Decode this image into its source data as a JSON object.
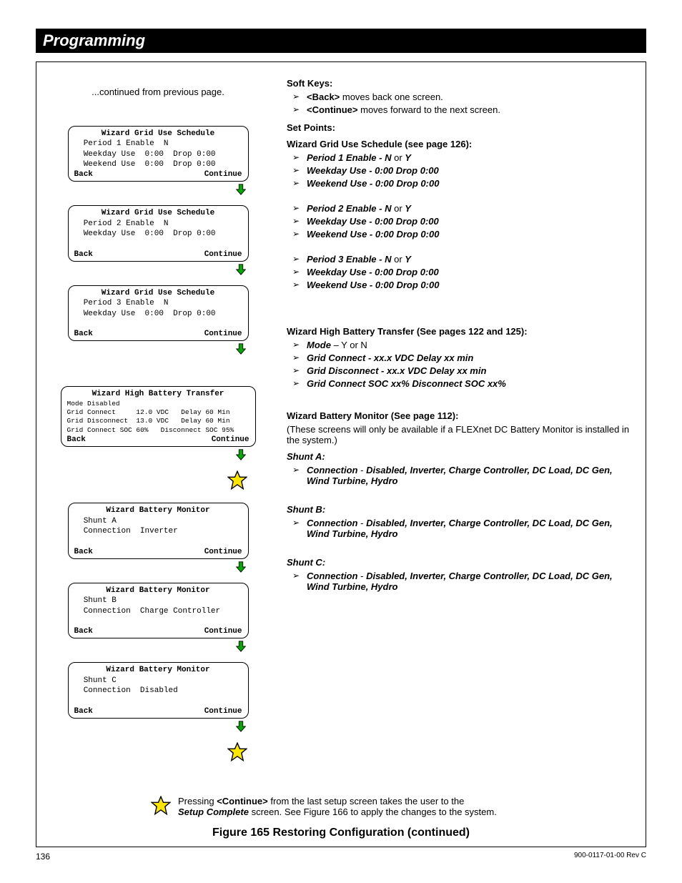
{
  "header": {
    "title": "Programming"
  },
  "continued": "...continued from previous page.",
  "lcd1": {
    "title": "Wizard Grid Use Schedule",
    "l1": "  Period 1 Enable  N",
    "l2": "  Weekday Use  0:00  Drop 0:00",
    "l3": "  Weekend Use  0:00  Drop 0:00",
    "back": "Back",
    "cont": "Continue"
  },
  "lcd2": {
    "title": "Wizard Grid Use Schedule",
    "l1": "  Period 2 Enable  N",
    "l2": "  Weekday Use  0:00  Drop 0:00",
    "back": "Back",
    "cont": "Continue"
  },
  "lcd3": {
    "title": "Wizard Grid Use Schedule",
    "l1": "  Period 3 Enable  N",
    "l2": "  Weekday Use  0:00  Drop 0:00",
    "back": "Back",
    "cont": "Continue"
  },
  "lcd4": {
    "title": "Wizard High Battery Transfer",
    "l1": "Mode Disabled",
    "l2": "Grid Connect     12.0 VDC   Delay 60 Min",
    "l3": "Grid Disconnect  13.0 VDC   Delay 60 Min",
    "l4": "Grid Connect SOC 60%   Disconnect SOC 95%",
    "back": "Back",
    "cont": "Continue"
  },
  "lcd5": {
    "title": "Wizard Battery Monitor",
    "l1": "  Shunt A",
    "l2": "  Connection  Inverter",
    "back": "Back",
    "cont": "Continue"
  },
  "lcd6": {
    "title": "Wizard Battery Monitor",
    "l1": "  Shunt B",
    "l2": "  Connection  Charge Controller",
    "back": "Back",
    "cont": "Continue"
  },
  "lcd7": {
    "title": "Wizard Battery Monitor",
    "l1": "  Shunt C",
    "l2": "  Connection  Disabled",
    "back": "Back",
    "cont": "Continue"
  },
  "right": {
    "softkeys_h": "Soft Keys:",
    "sk1a": "<Back>",
    "sk1b": " moves back one screen.",
    "sk2a": "<Continue>",
    "sk2b": " moves forward to the next screen.",
    "setpoints_h": "Set Points:",
    "wgus_h": "Wizard Grid Use Schedule (see page 126):",
    "p1a": "Period 1 Enable - N",
    "p1b": " or ",
    "p1c": "Y",
    "p1d": "Weekday Use - 0:00 Drop 0:00",
    "p1e": "Weekend Use - 0:00 Drop 0:00",
    "p2a": "Period 2 Enable - N",
    "p2b": " or ",
    "p2c": "Y",
    "p2d": "Weekday Use - 0:00 Drop 0:00",
    "p2e": "Weekend Use - 0:00 Drop 0:00",
    "p3a": "Period 3 Enable - N",
    "p3b": " or ",
    "p3c": "Y",
    "p3d": "Weekday Use - 0:00 Drop 0:00",
    "p3e": "Weekend Use - 0:00 Drop 0:00",
    "whbt_h": "Wizard High Battery Transfer (See pages 122 and 125):",
    "m1a": "Mode",
    "m1b": " – Y or N",
    "m2": "Grid Connect - xx.x VDC  Delay xx min",
    "m3": "Grid Disconnect - xx.x VDC  Delay xx min",
    "m4": "Grid Connect SOC xx%  Disconnect SOC xx%",
    "wbm_h": "Wizard Battery Monitor (See page 112):",
    "wbm_note": "(These screens will only be available if a FLEXnet DC Battery Monitor is installed in the system.)",
    "sa": "Shunt A:",
    "sb": "Shunt B:",
    "sc": "Shunt C:",
    "conn_a": "Connection",
    "conn_dash": " -  ",
    "conn_opts": "Disabled, Inverter, Charge Controller, DC Load, DC Gen, Wind Turbine, Hydro"
  },
  "note": {
    "t1": "Pressing ",
    "t2": "<Continue>",
    "t3": " from the last setup screen takes the user to the ",
    "t4": "Setup Complete",
    "t5": " screen.  See Figure 166 to apply the changes to the system."
  },
  "figure": "Figure 165     Restoring Configuration (continued)",
  "footer": {
    "page": "136",
    "rev": "900-0117-01-00 Rev C"
  }
}
